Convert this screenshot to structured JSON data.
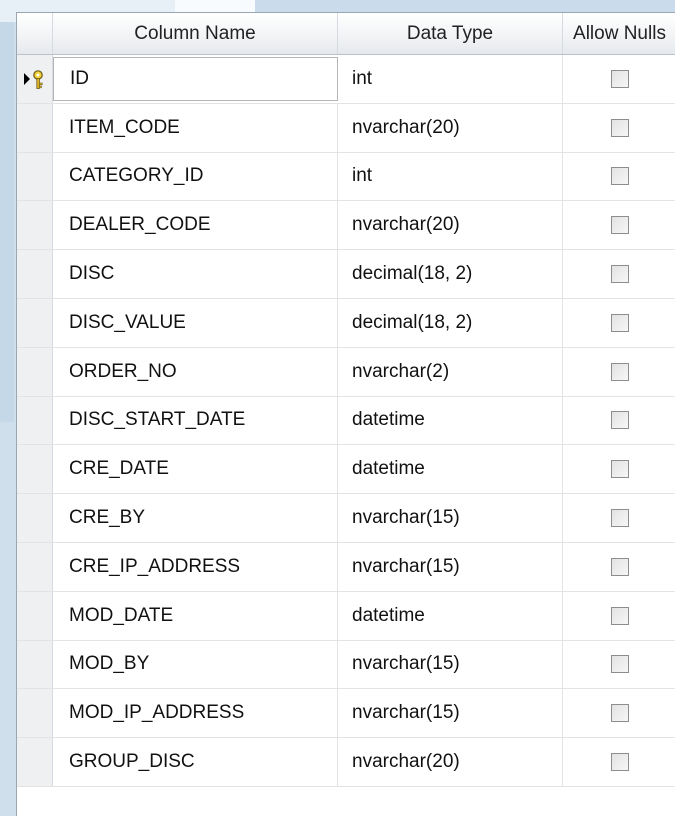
{
  "headers": {
    "column_name": "Column Name",
    "data_type": "Data Type",
    "allow_nulls": "Allow Nulls"
  },
  "rows": [
    {
      "name": "ID",
      "type": "int",
      "allow_nulls": false,
      "primary_key": true
    },
    {
      "name": "ITEM_CODE",
      "type": "nvarchar(20)",
      "allow_nulls": false
    },
    {
      "name": "CATEGORY_ID",
      "type": "int",
      "allow_nulls": false
    },
    {
      "name": "DEALER_CODE",
      "type": "nvarchar(20)",
      "allow_nulls": false
    },
    {
      "name": "DISC",
      "type": "decimal(18, 2)",
      "allow_nulls": false
    },
    {
      "name": "DISC_VALUE",
      "type": "decimal(18, 2)",
      "allow_nulls": false
    },
    {
      "name": "ORDER_NO",
      "type": "nvarchar(2)",
      "allow_nulls": false
    },
    {
      "name": "DISC_START_DATE",
      "type": "datetime",
      "allow_nulls": false
    },
    {
      "name": "CRE_DATE",
      "type": "datetime",
      "allow_nulls": false
    },
    {
      "name": "CRE_BY",
      "type": "nvarchar(15)",
      "allow_nulls": false
    },
    {
      "name": "CRE_IP_ADDRESS",
      "type": "nvarchar(15)",
      "allow_nulls": false
    },
    {
      "name": "MOD_DATE",
      "type": "datetime",
      "allow_nulls": false
    },
    {
      "name": "MOD_BY",
      "type": "nvarchar(15)",
      "allow_nulls": false
    },
    {
      "name": "MOD_IP_ADDRESS",
      "type": "nvarchar(15)",
      "allow_nulls": false
    },
    {
      "name": "GROUP_DISC",
      "type": "nvarchar(20)",
      "allow_nulls": false
    }
  ],
  "icons": {
    "row_marker": "current-row-arrow-icon",
    "primary_key": "primary-key-icon"
  }
}
